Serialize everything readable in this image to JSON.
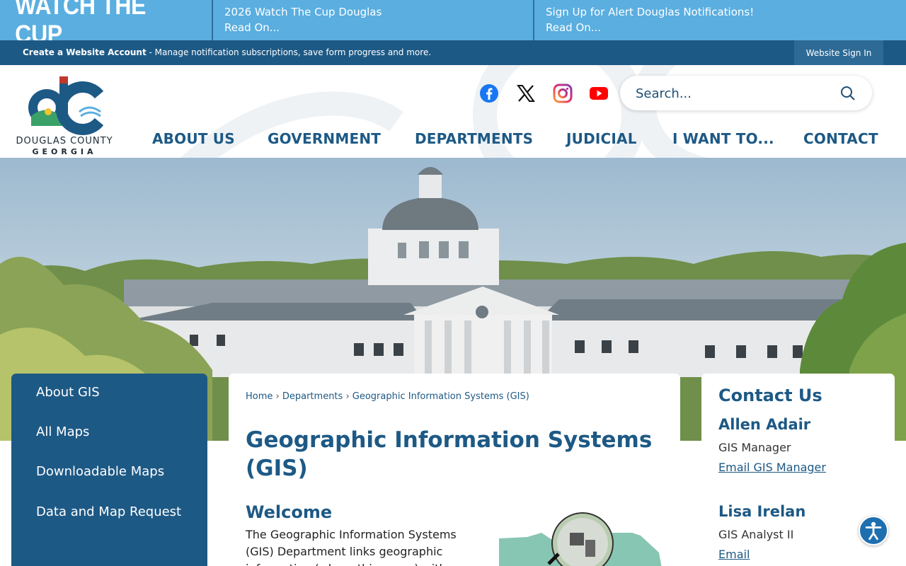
{
  "alert_bar": {
    "brand": "WATCH THE CUP",
    "items": [
      {
        "title": "2026 Watch The Cup Douglas",
        "link": "Read On..."
      },
      {
        "title": "Sign Up for Alert Douglas Notifications!",
        "link": "Read On..."
      }
    ]
  },
  "account_bar": {
    "create_label": "Create a Website Account",
    "description": " - Manage notification subscriptions, save form progress and more.",
    "signin_label": "Website Sign In"
  },
  "logo": {
    "line1": "DOUGLAS COUNTY",
    "line2": "GEORGIA"
  },
  "social": [
    "facebook-icon",
    "x-icon",
    "instagram-icon",
    "youtube-icon"
  ],
  "search": {
    "placeholder": "Search..."
  },
  "nav": {
    "items": [
      "ABOUT US",
      "GOVERNMENT",
      "DEPARTMENTS",
      "JUDICIAL",
      "I WANT TO...",
      "CONTACT"
    ]
  },
  "sidebar": {
    "items": [
      {
        "label": "About GIS"
      },
      {
        "label": "All Maps"
      },
      {
        "label": "Downloadable Maps"
      },
      {
        "label": "Data and Map Request"
      }
    ]
  },
  "breadcrumb": {
    "home": "Home",
    "departments": "Departments",
    "current": "Geographic Information Systems (GIS)"
  },
  "main": {
    "title": "Geographic Information Systems (GIS)",
    "welcome": "Welcome",
    "intro": "The Geographic Information Systems (GIS) Department links geographic information (where things are) with"
  },
  "contact": {
    "heading": "Contact Us",
    "people": [
      {
        "name": "Allen Adair",
        "role": "GIS Manager",
        "email_label": "Email GIS Manager"
      },
      {
        "name": "Lisa Irelan",
        "role": "GIS Analyst II",
        "email_label": "Email"
      }
    ]
  },
  "colors": {
    "alert_blue": "#5aaee0",
    "brand_navy": "#1d5985",
    "white": "#ffffff"
  }
}
